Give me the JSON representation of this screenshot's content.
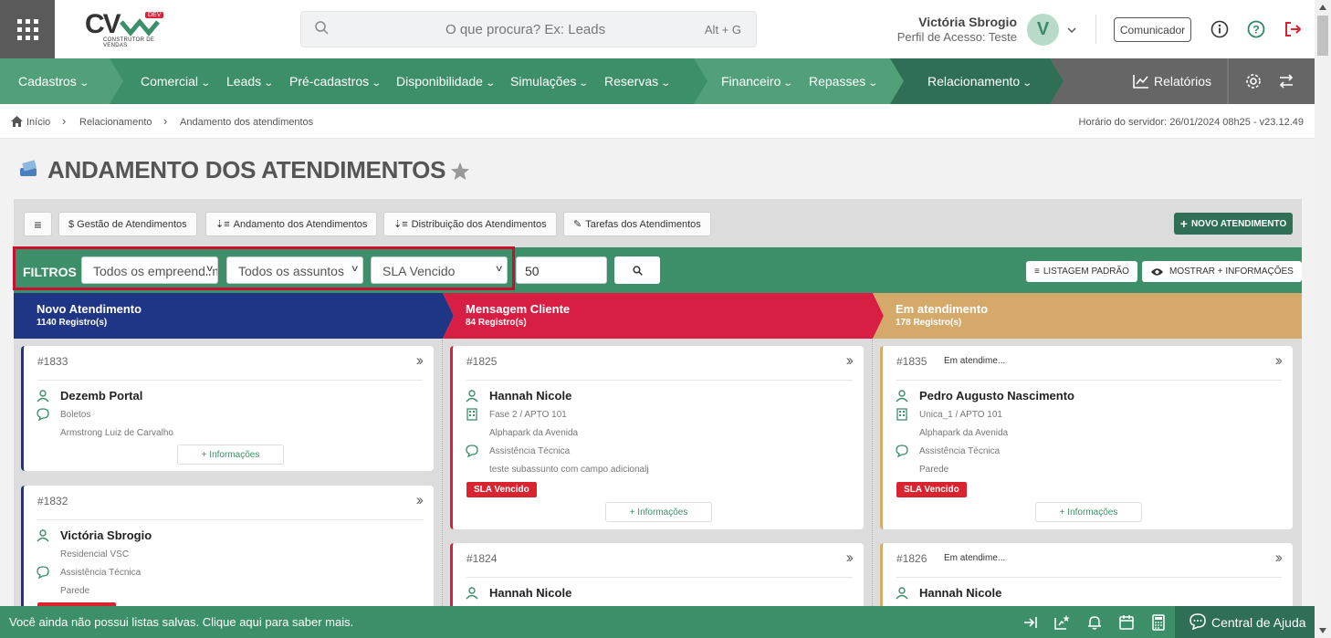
{
  "header": {
    "logo_text": "CV",
    "logo_badge": "DEV",
    "logo_sub": "CONSTRUTOR DE VENDAS",
    "search_placeholder": "O que procura? Ex: Leads",
    "search_shortcut": "Alt + G",
    "user_name": "Victória Sbrogio",
    "user_profile": "Perfil de Acesso: Teste",
    "avatar_initial": "V",
    "comunicador": "Comunicador"
  },
  "nav": {
    "items": [
      "Cadastros",
      "Comercial",
      "Leads",
      "Pré-cadastros",
      "Disponibilidade",
      "Simulações",
      "Reservas",
      "Financeiro",
      "Repasses",
      "Relacionamento"
    ],
    "reports": "Relatórios",
    "colors": {
      "base": "#3d8f69",
      "light": "#52a07a",
      "dark": "#2e6f55",
      "gray": "#666666"
    }
  },
  "breadcrumb": {
    "items": [
      "Início",
      "Relacionamento",
      "Andamento dos atendimentos"
    ],
    "server_time": "Horário do servidor: 26/01/2024 08h25 - v23.12.49"
  },
  "page": {
    "title": "ANDAMENTO DOS ATENDIMENTOS"
  },
  "toolbar": {
    "menu_icon": "≡",
    "buttons": [
      "$ Gestão de Atendimentos",
      "Andamento dos Atendimentos",
      "Distribuição dos Atendimentos",
      "Tarefas dos Atendimentos"
    ],
    "new_button": "NOVO ATENDIMENTO"
  },
  "filters": {
    "label": "FILTROS",
    "empreendimento": "Todos os empreendimentos",
    "assunto": "Todos os assuntos",
    "sla": "SLA Vencido",
    "limit": "50",
    "listagem": "LISTAGEM PADRÃO",
    "mostrar": "MOSTRAR + INFORMAÇÕES"
  },
  "columns": [
    {
      "title": "Novo Atendimento",
      "count": "1140 Registro(s)",
      "color": "#1f3585"
    },
    {
      "title": "Mensagem Cliente",
      "count": "84 Registro(s)",
      "color": "#d91e44"
    },
    {
      "title": "Em atendimento",
      "count": "178 Registro(s)",
      "color": "#d4a96a"
    }
  ],
  "cards": {
    "c1833": {
      "id": "#1833",
      "name": "Dezemb Portal",
      "subject": "Boletos",
      "agent": "Armstrong Luiz de Carvalho",
      "info": "+ Informações"
    },
    "c1832": {
      "id": "#1832",
      "name": "Victória Sbrogio",
      "property": "Residencial VSC",
      "subject": "Assistência Técnica",
      "detail": "Parede"
    },
    "c1825": {
      "id": "#1825",
      "name": "Hannah Nicole",
      "unit": "Fase 2 / APTO 101",
      "property": "Alphapark da Avenida",
      "subject": "Assistência Técnica",
      "detail": "teste subassunto com campo adicionalj",
      "sla": "SLA Vencido",
      "info": "+ Informações"
    },
    "c1824": {
      "id": "#1824",
      "name": "Hannah Nicole"
    },
    "c1835": {
      "id": "#1835",
      "status": "Em atendime...",
      "name": "Pedro Augusto Nascimento",
      "unit": "Unica_1 / APTO 101",
      "property": "Alphapark da Avenida",
      "subject": "Assistência Técnica",
      "detail": "Parede",
      "sla": "SLA Vencido",
      "info": "+ Informações"
    },
    "c1826": {
      "id": "#1826",
      "status": "Em atendime...",
      "name": "Hannah Nicole"
    }
  },
  "footer": {
    "message": "Você ainda não possui listas salvas. Clique aqui para saber mais.",
    "help": "Central de Ajuda"
  }
}
